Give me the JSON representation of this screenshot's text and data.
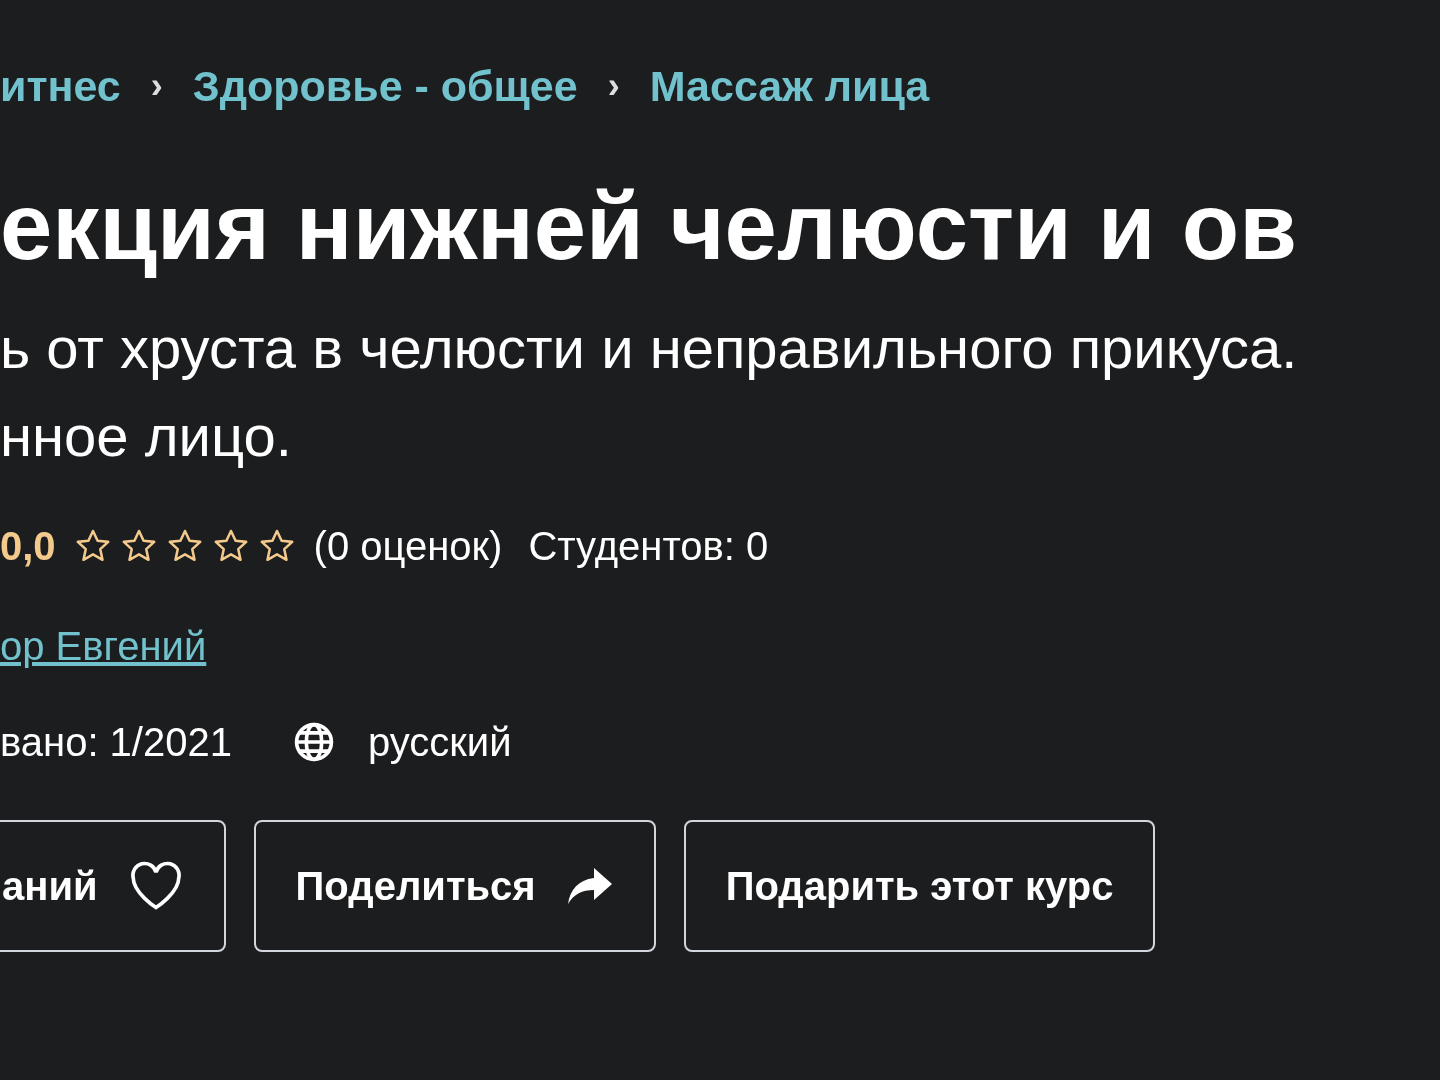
{
  "breadcrumbs": [
    {
      "label": "итнес"
    },
    {
      "label": "Здоровье - общее"
    },
    {
      "label": "Массаж лица"
    }
  ],
  "breadcrumb_separator": "›",
  "title": "екция нижней челюсти и ов",
  "subtitle_lines": [
    "ь от хруста в челюсти и неправильного прикуса.",
    "нное лицо."
  ],
  "rating": {
    "value": "0,0",
    "stars": 0,
    "count": "(0 оценок)",
    "students": "Студентов: 0"
  },
  "author_link": "ор Евгений",
  "meta": {
    "updated": "вано: 1/2021",
    "language": "русский"
  },
  "buttons": [
    {
      "label": "аний",
      "kind": "wishlist"
    },
    {
      "label": "Поделиться",
      "kind": "share"
    },
    {
      "label": "Подарить этот курс",
      "kind": "plain"
    }
  ]
}
